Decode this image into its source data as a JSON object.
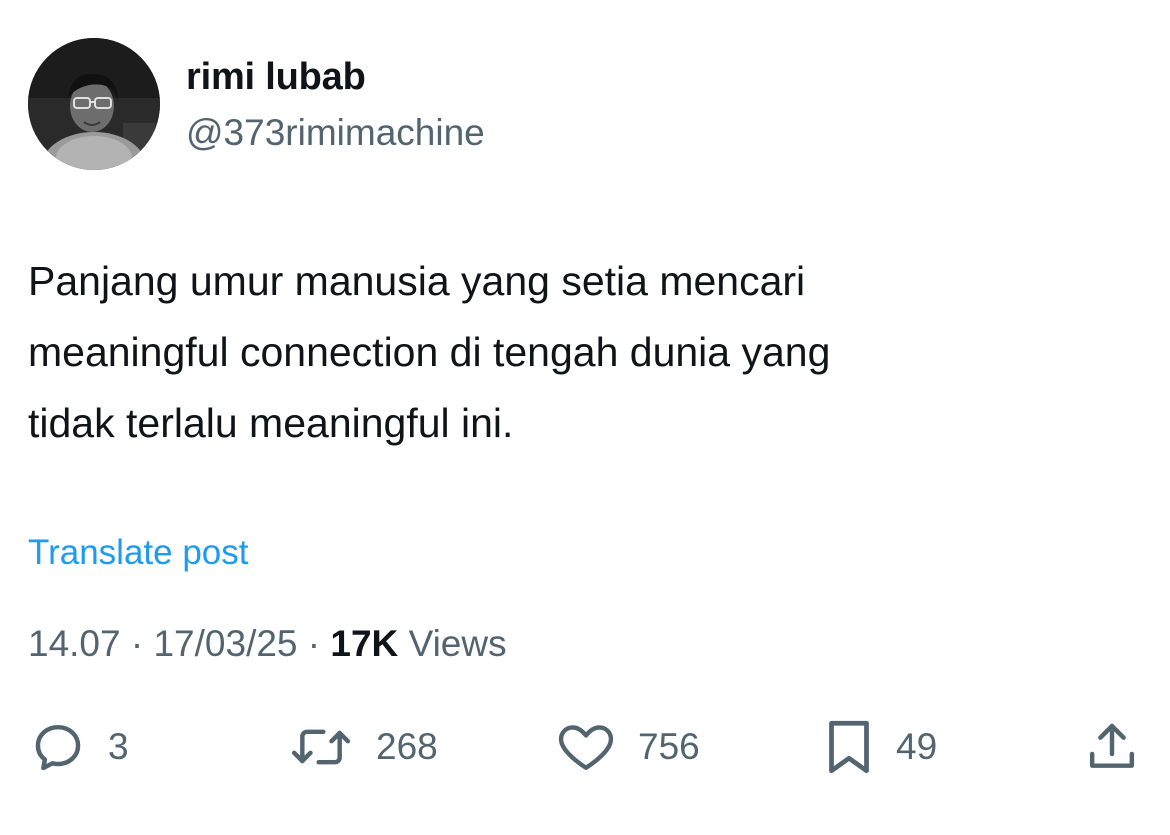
{
  "author": {
    "display_name": "rimi lubab",
    "handle": "@373rimimachine",
    "avatar": "profile-photo"
  },
  "post": {
    "text": "Panjang umur manusia yang setia mencari\nmeaningful connection di tengah dunia yang\ntidak terlalu meaningful ini.",
    "translate_label": "Translate post"
  },
  "meta": {
    "time": "14.07",
    "separator": "·",
    "date": "17/03/25",
    "views_count": "17K",
    "views_label": "Views"
  },
  "actions": {
    "replies": {
      "icon": "reply-icon",
      "count": "3"
    },
    "reposts": {
      "icon": "repost-icon",
      "count": "268"
    },
    "likes": {
      "icon": "heart-icon",
      "count": "756"
    },
    "bookmarks": {
      "icon": "bookmark-icon",
      "count": "49"
    },
    "share": {
      "icon": "share-icon"
    }
  },
  "colors": {
    "text_primary": "#0f1419",
    "text_secondary": "#536471",
    "link": "#1d9bf0",
    "background": "#ffffff"
  }
}
